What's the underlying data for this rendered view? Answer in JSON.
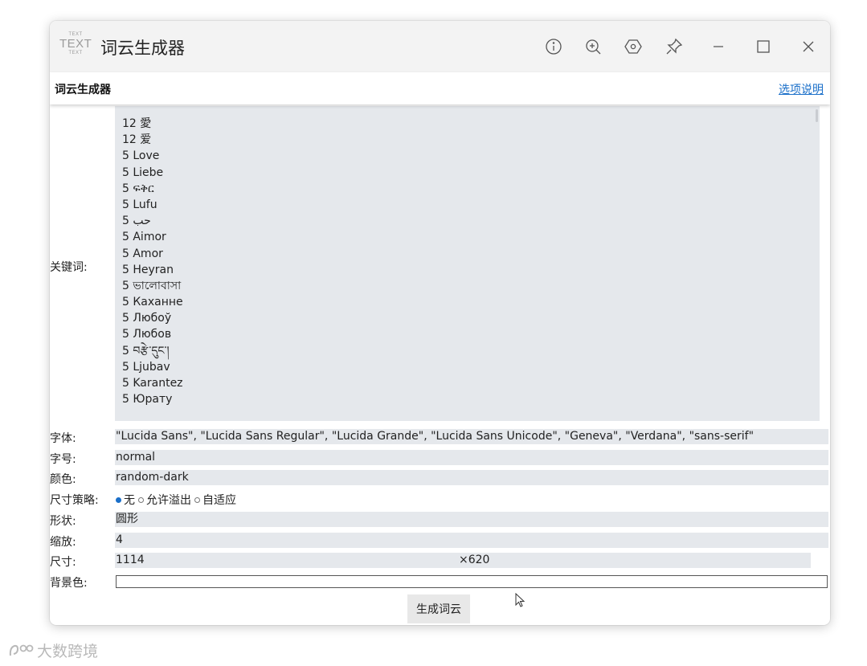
{
  "window": {
    "logo_small_top": "TEXT",
    "logo_big": "TEXT",
    "logo_small_bottom": "TEXT",
    "title": "词云生成器"
  },
  "subbar": {
    "title": "词云生成器",
    "options_link": "选项说明"
  },
  "form": {
    "keywords_label": "关键词:",
    "keywords": [
      "12 愛",
      "12 爱",
      "5 Love",
      "5 Liebe",
      "5 ፍቅር",
      "5 Lufu",
      "5 حب",
      "5 Aimor",
      "5 Amor",
      "5 Heyran",
      "5 ভালোবাসা",
      "5 Каханне",
      "5 Любоў",
      "5 Любов",
      "5 བརྩེ་དུང་།",
      "5 Ljubav",
      "5 Karantez",
      "5 Юрату"
    ],
    "font_label": "字体:",
    "font_value": "\"Lucida Sans\", \"Lucida Sans Regular\", \"Lucida Grande\", \"Lucida Sans Unicode\", \"Geneva\", \"Verdana\", \"sans-serif\"",
    "fontsize_label": "字号:",
    "fontsize_value": "normal",
    "color_label": "颜色:",
    "color_value": "random-dark",
    "strategy_label": "尺寸策略:",
    "strategy_options": [
      "无",
      "允许溢出",
      "自适应"
    ],
    "strategy_selected": "无",
    "shape_label": "形状:",
    "shape_value": "圆形",
    "scale_label": "缩放:",
    "scale_value": "4",
    "size_label": "尺寸:",
    "size_width": "1114",
    "size_height": "×620",
    "bg_label": "背景色:",
    "bg_value": "",
    "generate_button": "生成词云"
  },
  "watermark": "大数跨境",
  "colors": {
    "link": "#1a6fc9",
    "field_bg": "#e5e8ec",
    "titlebar_bg": "#f3f3f3"
  }
}
